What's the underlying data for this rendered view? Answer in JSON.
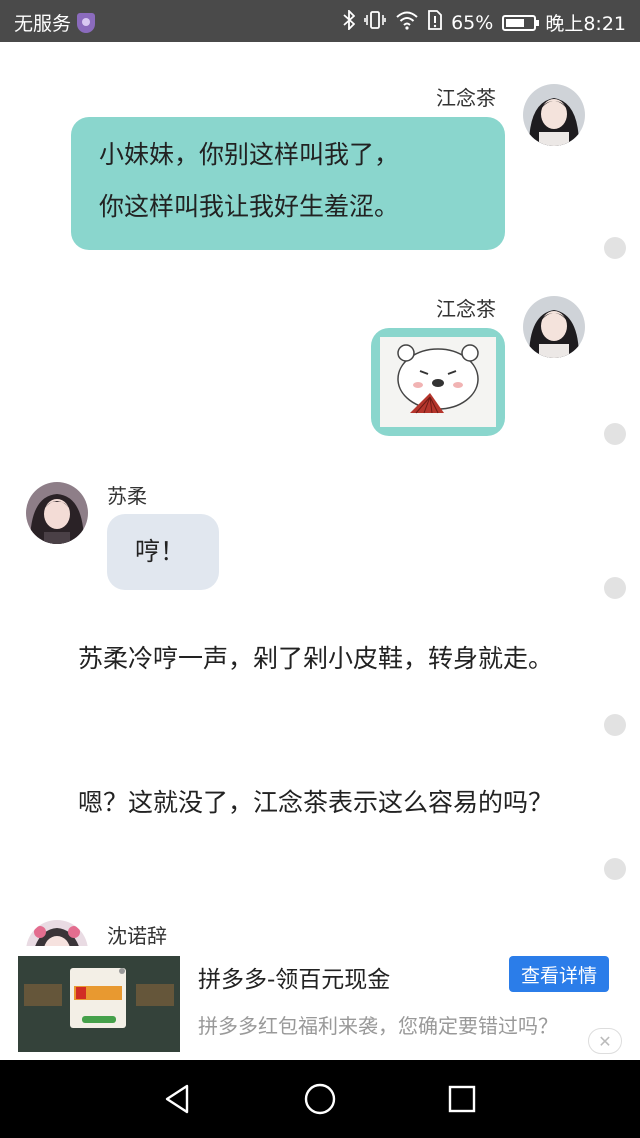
{
  "status_bar": {
    "carrier": "无服务",
    "battery_percent": "65%",
    "time": "晚上8:21",
    "icons": [
      "shield-icon",
      "bluetooth-icon",
      "vibrate-icon",
      "wifi-icon",
      "sim-alert-icon",
      "battery-icon"
    ]
  },
  "chat": {
    "messages": [
      {
        "sender": "江念茶",
        "side": "right",
        "lines": [
          "小妹妹，你别这样叫我了，",
          "你这样叫我让我好生羞涩。"
        ]
      },
      {
        "sender": "江念茶",
        "side": "right",
        "type": "sticker"
      },
      {
        "sender": "苏柔",
        "side": "left",
        "lines": [
          "哼！"
        ]
      },
      {
        "sender": "沈诺辞",
        "side": "left"
      }
    ],
    "paragraphs": [
      "　　苏柔冷哼一声，剁了剁小皮鞋，转身就走。",
      "　　嗯？这就没了，江念茶表示这么容易的吗？"
    ]
  },
  "ad": {
    "title": "拼多多-领百元现金",
    "button": "查看详情",
    "subtitle": "拼多多红包福利来袭，您确定要错过吗？",
    "close": "✕"
  },
  "nav": {
    "icons": [
      "back-icon",
      "home-icon",
      "recents-icon"
    ]
  }
}
